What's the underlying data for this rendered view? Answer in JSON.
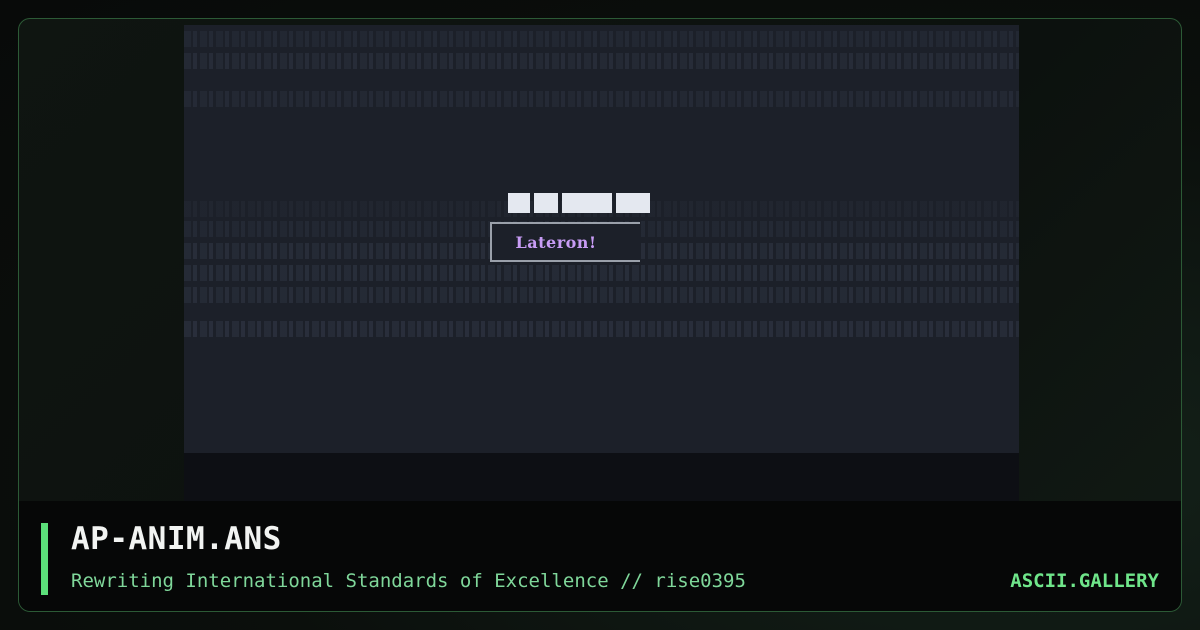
{
  "artwork": {
    "title": "AP-ANIM.ANS",
    "subtitle": "Rewriting International Standards of Excellence // rise0395",
    "preview_caption": "Lateron!"
  },
  "site": {
    "brand": "ASCII.GALLERY"
  },
  "colors": {
    "accent": "#5ce07a",
    "brand_text": "#6fe58a",
    "preview_background": "#1c2029",
    "caption_text": "#c89cf5"
  }
}
